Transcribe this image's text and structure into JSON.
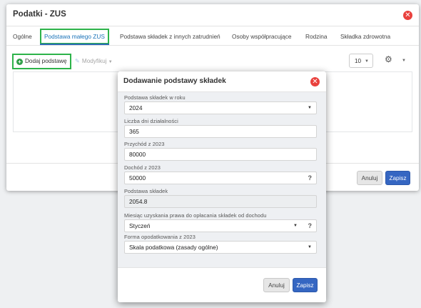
{
  "main": {
    "title": "Podatki - ZUS",
    "tabs": [
      {
        "label": "Ogólne"
      },
      {
        "label": "Podstawa małego ZUS"
      },
      {
        "label": "Podstawa składek z innych zatrudnień"
      },
      {
        "label": "Osoby współpracujące"
      },
      {
        "label": "Rodzina"
      },
      {
        "label": "Składka zdrowotna"
      }
    ],
    "add_label": "Dodaj podstawę",
    "modify_label": "Modyfikuj",
    "page_size": "10",
    "cancel_label": "Anuluj",
    "save_label": "Zapisz"
  },
  "modal": {
    "title": "Dodawanie podstawy składek",
    "fields": [
      {
        "label": "Podstawa składek w roku",
        "value": "2024",
        "type": "select"
      },
      {
        "label": "Liczba dni działalności",
        "value": "365",
        "type": "input"
      },
      {
        "label": "Przychód z 2023",
        "value": "80000",
        "type": "input"
      },
      {
        "label": "Dochód z 2023",
        "value": "50000",
        "type": "input-help"
      },
      {
        "label": "Podstawa składek",
        "value": "2054.8",
        "type": "readonly"
      },
      {
        "label": "Miesiąc uzyskania prawa do opłacania składek od dochodu",
        "value": "Styczeń",
        "type": "select-help"
      },
      {
        "label": "Forma opodatkowania z 2023",
        "value": "Skala podatkowa (zasady ogólne)",
        "type": "select"
      }
    ],
    "help_symbol": "?",
    "cancel_label": "Anuluj",
    "save_label": "Zapisz"
  },
  "icons": {
    "close": "close-icon",
    "plus": "plus-circle-icon",
    "pencil": "edit-icon",
    "gear": "gears-icon"
  },
  "colors": {
    "highlight_green": "#2db34a",
    "primary_blue": "#3566c2",
    "close_red": "#e9413d"
  }
}
